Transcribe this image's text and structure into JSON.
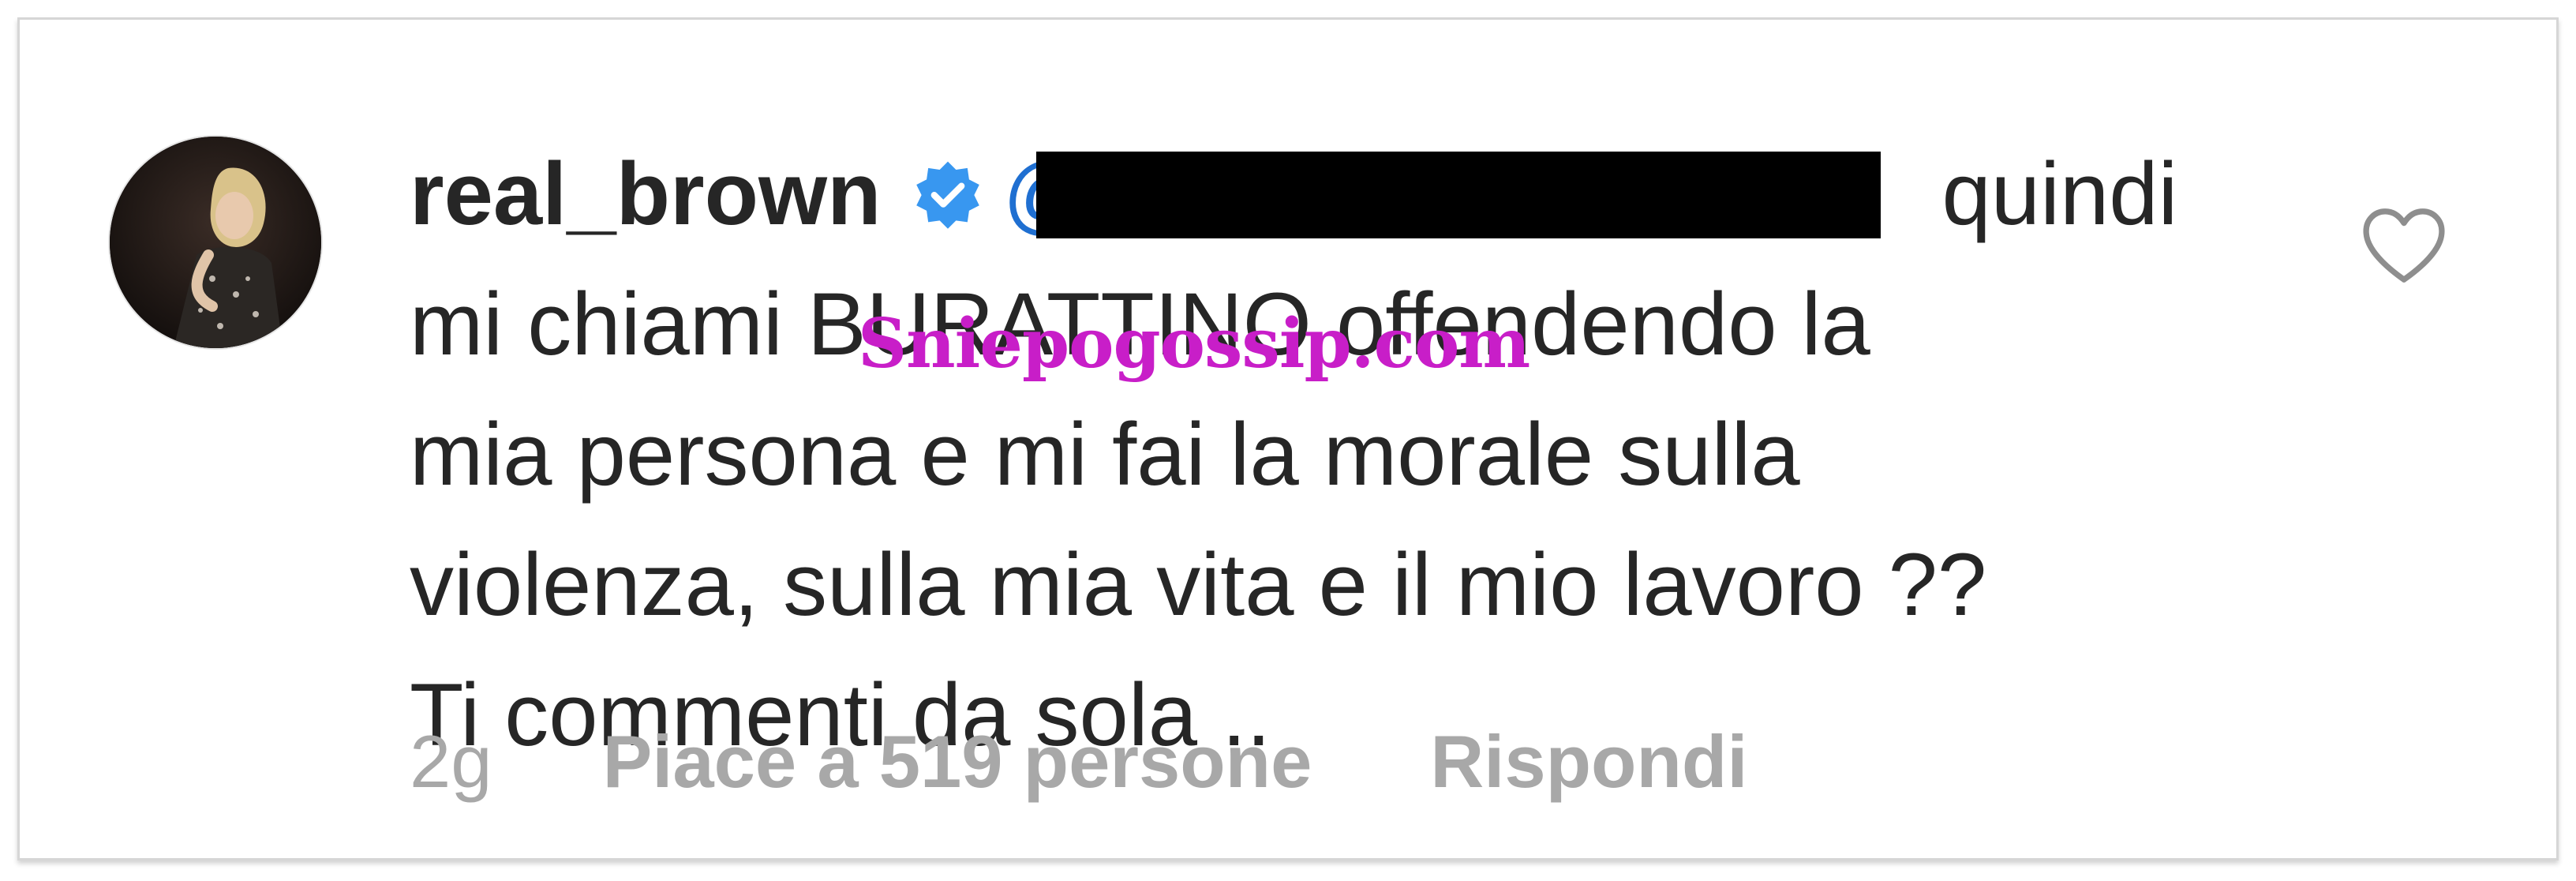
{
  "comment": {
    "username": "real_brown",
    "verified_icon": "verified-badge-icon",
    "mention_prefix": "@",
    "lines": [
      "quindi",
      "mi chiami BURATTINO  offendendo la",
      "mia persona e mi fai la  morale sulla",
      "violenza, sulla mia vita e il mio lavoro ??",
      "Ti commenti da sola .."
    ]
  },
  "watermark": "Sniepogossip.com",
  "meta": {
    "time": "2g",
    "likes": "Piace a 519 persone",
    "reply": "Rispondi"
  },
  "icons": {
    "like": "heart-icon",
    "avatar": "profile-avatar"
  },
  "colors": {
    "text": "#262626",
    "secondary": "#a8a8a8",
    "verified": "#3897f0",
    "mention": "#003569",
    "watermark": "#c81ec8"
  }
}
